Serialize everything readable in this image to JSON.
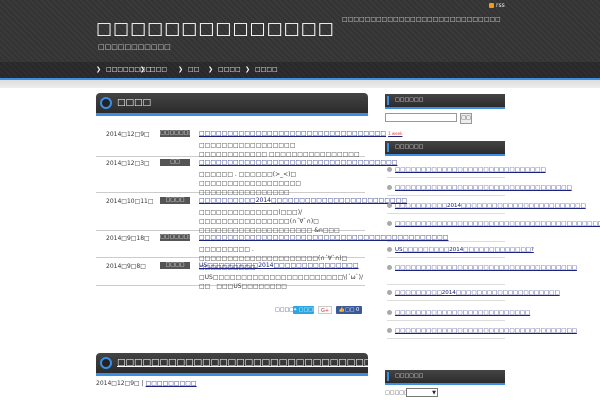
{
  "header": {
    "site_title": "□□□□□□□□□□□□□□",
    "site_description": "□□□□□□□□□□□",
    "tagline": "□□□□□□□□□□□□□□□□□□□□□□□□□□□□",
    "rss_label": "rss"
  },
  "nav": {
    "items": [
      {
        "label": "□□□□□□□□"
      },
      {
        "label": "□□□"
      },
      {
        "label": "□□"
      },
      {
        "label": "□□□□"
      },
      {
        "label": "□□□□"
      }
    ]
  },
  "news": {
    "title": "□□□□",
    "items": [
      {
        "date": "2014□12□9□",
        "category": "□□□□□□□□□",
        "title": "□□□□□□□□□□□□□□□□□□□□□□□□□□□□□□□□□",
        "new_tag": "1 week",
        "excerpt": "□□□□□□□□□□□□□□□□□　□□□□□□□□□□□□ □□□□□□□□□□□□□□□□"
      },
      {
        "date": "2014□12□3□",
        "category": "□□",
        "title": "□□□□□□□□□□□□□□□□□□□□□□□□□□□□□□□□□□□",
        "new_tag": "",
        "excerpt": "□□□□□□ . □□□□□□(>_<)□ □□□□□□□□□□□□□□□□□□ □□□□□□□□□□□□□□□□"
      },
      {
        "date": "2014□10□11□",
        "category": "□□□□",
        "title": "□□□□□□□□□□2014□□□□□□□□□□□□□□□□□□□□□□□□",
        "new_tag": "",
        "excerpt": "□□□□□□□□□□□□□□(□□□)/ □□□□□□□□□□□□□□□□(∩´∀`∩)□ □□□□□□□□□□□□□□□□□□□□ &n□□□"
      },
      {
        "date": "2014□9□18□",
        "category": "□□□□□□□□",
        "title": "□□□□□□□□□□□□□□□□□□□□□□□□□□□□□□□□□□□□□□□□□□□□",
        "new_tag": "",
        "excerpt": "□□□□□□□□□ . □□□□□□□□□□□□□□□□□□□□□(∩´∀`∩)□　□□□□□□□□□□"
      },
      {
        "date": "2014□9□8□",
        "category": "□□□□",
        "title": "US□□□□□□□□□2014□□□□□□□□□□□□□□□",
        "new_tag": "",
        "excerpt": "□US□□□□□□□□□□□□□□□□□□□□□□□\\(´ω`)/□□　□□□US□□□□□□□□"
      }
    ],
    "share": {
      "label": "□□□□",
      "twitter": "□□□□",
      "gplus": "G+",
      "facebook": "□□ 0"
    }
  },
  "post": {
    "title": "□□□□□□□□□□□□□□□□□□□□□□□□□□□□□□□□□□□",
    "date": "2014□12□9□",
    "category": "□□□□□□□□□"
  },
  "sidebar": {
    "search_title": "□□□□□□",
    "search_button": "□□",
    "recent_title": "□□□□□□",
    "recent_items": [
      "□□□□□□□□□□□□□□□□□□□□□□□□□□□□□",
      "□□□□□□□□□□□□□□□□□□□□□□□□□□□□□□□□□□",
      "□□□□□□□□□□2014□□□□□□□□□□□□□□□□□□□□□□□□",
      "□□□□□□□□□□□□□□□□□□□□□□□□□□□□□□□□□□□□□□□□□□□□",
      "US□□□□□□□□□2014□□□□□□□□□□□□□?",
      "□□□□□□□□□□□□□□□□□□□□□□□□□□□□□□□□□□□",
      "□□□□□□□□□2014□□□□□□□□□□□□□□□□□□□□",
      "□□□□□□□□□□□□□□□□□□□□□□□□□□",
      "□□□□□□□□□□□□□□□□□□□□□□□□□□□□□□□□□□□"
    ],
    "category_title": "□□□□□□",
    "category_label": "□□□□□□"
  },
  "colors": {
    "accent": "#3a8ee6",
    "header_bg": "#333333",
    "link": "#1a237e"
  }
}
